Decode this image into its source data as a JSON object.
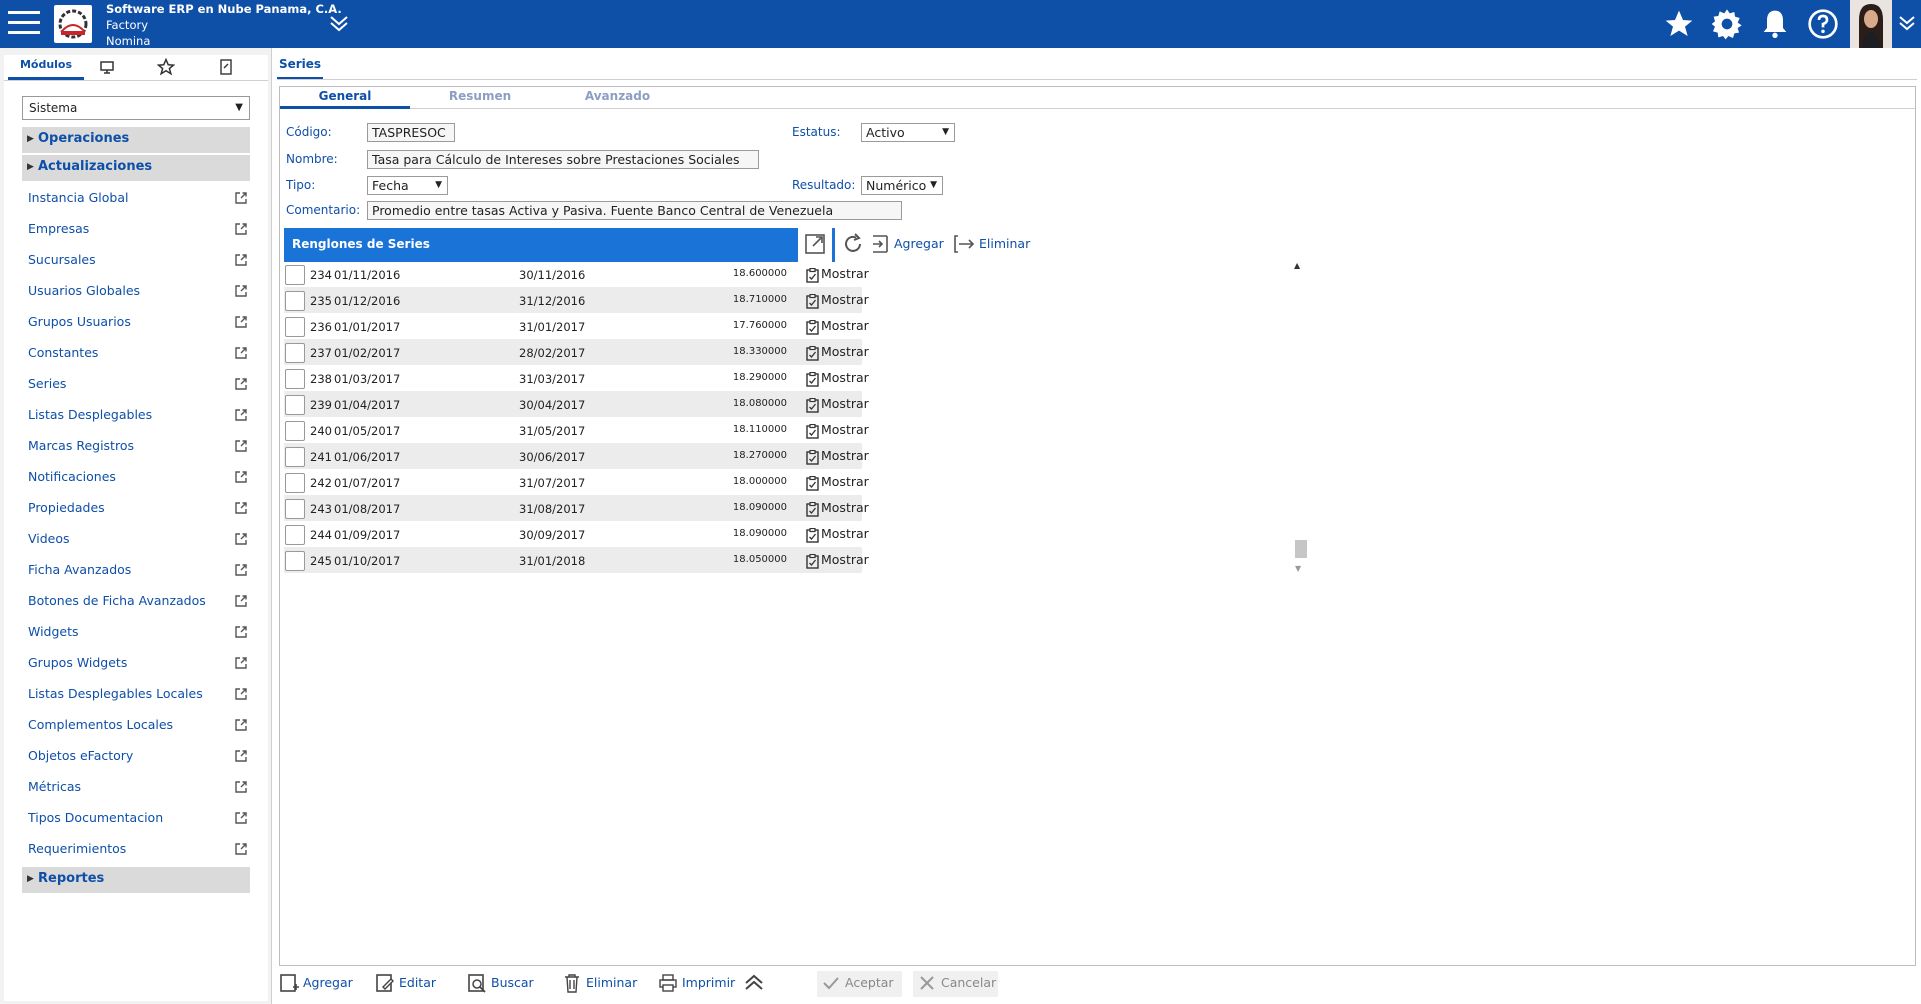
{
  "header": {
    "company": "Software ERP en Nube Panama, C.A.",
    "product": "Factory",
    "module": "Nomina"
  },
  "sidebar": {
    "tabs": {
      "modulos": "Módulos"
    },
    "system_select": "Sistema",
    "sections": {
      "operaciones": "Operaciones",
      "actualizaciones": "Actualizaciones",
      "reportes": "Reportes"
    },
    "items": [
      "Instancia Global",
      "Empresas",
      "Sucursales",
      "Usuarios Globales",
      "Grupos Usuarios",
      "Constantes",
      "Series",
      "Listas Desplegables",
      "Marcas Registros",
      "Notificaciones",
      "Propiedades",
      "Videos",
      "Ficha Avanzados",
      "Botones de Ficha Avanzados",
      "Widgets",
      "Grupos Widgets",
      "Listas Desplegables Locales",
      "Complementos Locales",
      "Objetos eFactory",
      "Métricas",
      "Tipos Documentacion",
      "Requerimientos"
    ]
  },
  "main": {
    "tab": "Series",
    "subtabs": {
      "general": "General",
      "resumen": "Resumen",
      "avanzado": "Avanzado"
    },
    "form": {
      "codigo_label": "Código:",
      "codigo": "TASPRESOC",
      "nombre_label": "Nombre:",
      "nombre": "Tasa para Cálculo de Intereses sobre Prestaciones Sociales",
      "tipo_label": "Tipo:",
      "tipo": "Fecha",
      "comentario_label": "Comentario:",
      "comentario": "Promedio entre tasas Activa y Pasiva. Fuente Banco Central de Venezuela",
      "estatus_label": "Estatus:",
      "estatus": "Activo",
      "resultado_label": "Resultado:",
      "resultado": "Numérico"
    },
    "grid": {
      "title": "Renglones de Series",
      "add_label": "Agregar",
      "delete_label": "Eliminar",
      "rows": [
        {
          "num": "234",
          "desde": "01/11/2016",
          "hasta": "30/11/2016",
          "valor": "18.600000",
          "action": "Mostrar"
        },
        {
          "num": "235",
          "desde": "01/12/2016",
          "hasta": "31/12/2016",
          "valor": "18.710000",
          "action": "Mostrar"
        },
        {
          "num": "236",
          "desde": "01/01/2017",
          "hasta": "31/01/2017",
          "valor": "17.760000",
          "action": "Mostrar"
        },
        {
          "num": "237",
          "desde": "01/02/2017",
          "hasta": "28/02/2017",
          "valor": "18.330000",
          "action": "Mostrar"
        },
        {
          "num": "238",
          "desde": "01/03/2017",
          "hasta": "31/03/2017",
          "valor": "18.290000",
          "action": "Mostrar"
        },
        {
          "num": "239",
          "desde": "01/04/2017",
          "hasta": "30/04/2017",
          "valor": "18.080000",
          "action": "Mostrar"
        },
        {
          "num": "240",
          "desde": "01/05/2017",
          "hasta": "31/05/2017",
          "valor": "18.110000",
          "action": "Mostrar"
        },
        {
          "num": "241",
          "desde": "01/06/2017",
          "hasta": "30/06/2017",
          "valor": "18.270000",
          "action": "Mostrar"
        },
        {
          "num": "242",
          "desde": "01/07/2017",
          "hasta": "31/07/2017",
          "valor": "18.000000",
          "action": "Mostrar"
        },
        {
          "num": "243",
          "desde": "01/08/2017",
          "hasta": "31/08/2017",
          "valor": "18.090000",
          "action": "Mostrar"
        },
        {
          "num": "244",
          "desde": "01/09/2017",
          "hasta": "30/09/2017",
          "valor": "18.090000",
          "action": "Mostrar"
        },
        {
          "num": "245",
          "desde": "01/10/2017",
          "hasta": "31/01/2018",
          "valor": "18.050000",
          "action": "Mostrar"
        }
      ]
    }
  },
  "actions": {
    "agregar": "Agregar",
    "editar": "Editar",
    "buscar": "Buscar",
    "eliminar": "Eliminar",
    "imprimir": "Imprimir",
    "aceptar": "Aceptar",
    "cancelar": "Cancelar"
  },
  "colors": {
    "topbar": "#0e4fa8",
    "grid_header": "#1a73d6",
    "link": "#0e4fa8"
  }
}
